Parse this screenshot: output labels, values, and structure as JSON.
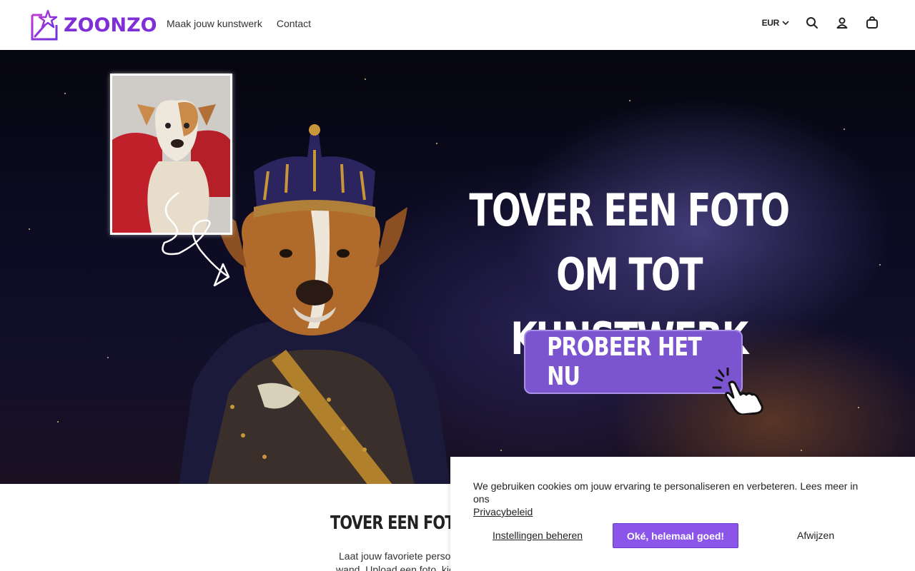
{
  "brand": {
    "name": "ZOONZO",
    "color": "#7e2fd6"
  },
  "nav": {
    "items": [
      "Maak jouw kunstwerk",
      "Contact"
    ]
  },
  "header": {
    "currency": "EUR",
    "icons": [
      "search-icon",
      "account-icon",
      "cart-icon"
    ]
  },
  "hero": {
    "title_line1": "TOVER EEN FOTO",
    "title_line2": "OM TOT KUNSTWERK",
    "cta_label": "PROBEER HET NU",
    "cta_color": "#7b55cf"
  },
  "section": {
    "title": "TOVER EEN FOTO O",
    "text_line1": "Laat jouw favoriete persoo",
    "text_line2": "wand. Upload een foto, kies"
  },
  "cookie": {
    "text": "We gebruiken cookies om jouw ervaring te personaliseren en verbeteren. Lees meer in ons",
    "link": "Privacybeleid",
    "settings_label": "Instellingen beheren",
    "accept_label": "Oké, helemaal goed!",
    "reject_label": "Afwijzen",
    "accent": "#8b55ea"
  }
}
